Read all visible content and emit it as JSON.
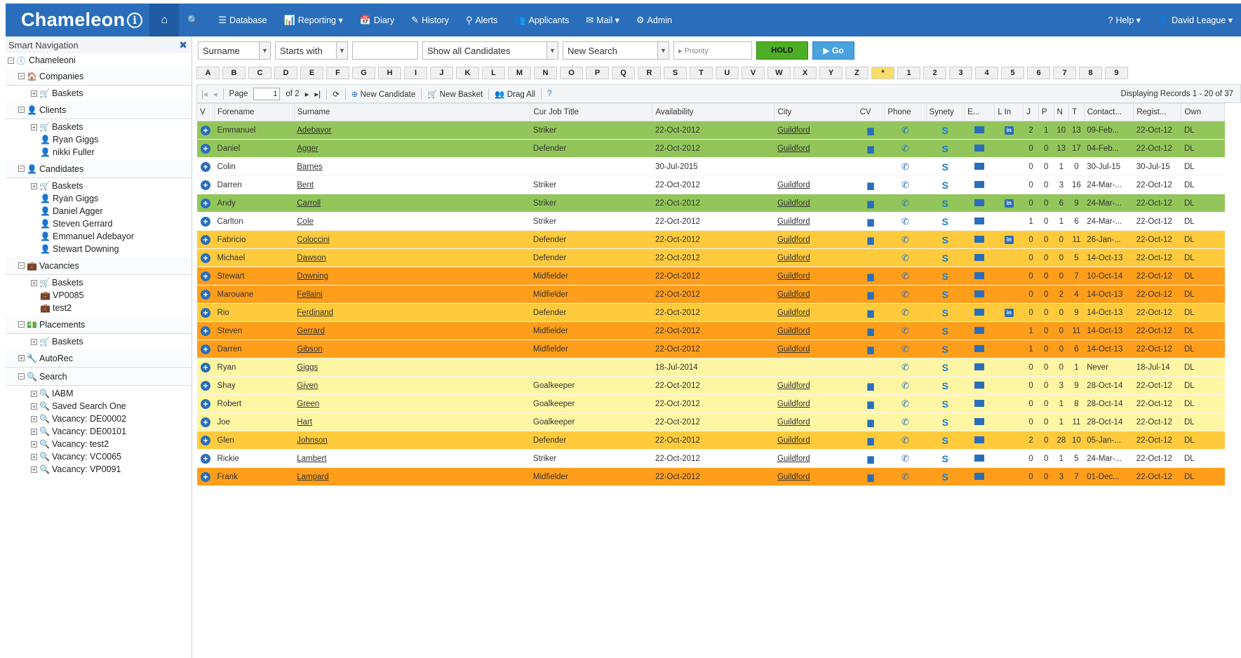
{
  "app": {
    "brand": "Chameleon",
    "brand_suffix": "i"
  },
  "nav": {
    "items": [
      {
        "icon": "🔍",
        "label": ""
      },
      {
        "icon": "☰",
        "label": "Database"
      },
      {
        "icon": "📊",
        "label": "Reporting ▾"
      },
      {
        "icon": "📅",
        "label": "Diary"
      },
      {
        "icon": "✎",
        "label": "History"
      },
      {
        "icon": "⚲",
        "label": "Alerts"
      },
      {
        "icon": "👥",
        "label": "Applicants"
      },
      {
        "icon": "✉",
        "label": "Mail ▾"
      },
      {
        "icon": "⚙",
        "label": "Admin"
      }
    ],
    "help": "Help ▾",
    "user": "David League ▾"
  },
  "sidebar": {
    "title": "Smart Navigation",
    "root": "Chameleoni",
    "sections": [
      {
        "label": "Companies",
        "icon": "🏠",
        "children": [
          {
            "label": "Baskets",
            "icon": "🛒",
            "pm": "+"
          }
        ]
      },
      {
        "label": "Clients",
        "icon": "👤",
        "children": [
          {
            "label": "Baskets",
            "icon": "🛒",
            "pm": "+"
          },
          {
            "label": "Ryan Giggs",
            "icon": "👤",
            "pm": ""
          },
          {
            "label": "nikki Fuller",
            "icon": "👤",
            "pm": ""
          }
        ]
      },
      {
        "label": "Candidates",
        "icon": "👤",
        "children": [
          {
            "label": "Baskets",
            "icon": "🛒",
            "pm": "+"
          },
          {
            "label": "Ryan Giggs",
            "icon": "👤",
            "pm": ""
          },
          {
            "label": "Daniel Agger",
            "icon": "👤",
            "pm": ""
          },
          {
            "label": "Steven Gerrard",
            "icon": "👤",
            "pm": ""
          },
          {
            "label": "Emmanuel Adebayor",
            "icon": "👤",
            "pm": ""
          },
          {
            "label": "Stewart Downing",
            "icon": "👤",
            "pm": ""
          }
        ]
      },
      {
        "label": "Vacancies",
        "icon": "💼",
        "children": [
          {
            "label": "Baskets",
            "icon": "🛒",
            "pm": "+"
          },
          {
            "label": "VP0085",
            "icon": "💼",
            "pm": ""
          },
          {
            "label": "test2",
            "icon": "💼",
            "pm": ""
          }
        ]
      },
      {
        "label": "Placements",
        "icon": "💵",
        "children": [
          {
            "label": "Baskets",
            "icon": "🛒",
            "pm": "+"
          }
        ]
      },
      {
        "label": "AutoRec",
        "icon": "🔧",
        "pm": "+",
        "children": []
      },
      {
        "label": "Search",
        "icon": "🔍",
        "children": [
          {
            "label": "IABM",
            "icon": "🔍",
            "pm": "+"
          },
          {
            "label": "Saved Search One",
            "icon": "🔍",
            "pm": "+"
          },
          {
            "label": "Vacancy: DE00002",
            "icon": "🔍",
            "pm": "+"
          },
          {
            "label": "Vacancy: DE00101",
            "icon": "🔍",
            "pm": "+"
          },
          {
            "label": "Vacancy: test2",
            "icon": "🔍",
            "pm": "+"
          },
          {
            "label": "Vacancy: VC0065",
            "icon": "🔍",
            "pm": "+"
          },
          {
            "label": "Vacancy: VP0091",
            "icon": "🔍",
            "pm": "+"
          }
        ]
      }
    ]
  },
  "filters": {
    "field": "Surname",
    "operator": "Starts with",
    "value": "",
    "show": "Show all Candidates",
    "search": "New Search",
    "priority_placeholder": "▸ Priority",
    "hold": "HOLD",
    "go": "▶ Go"
  },
  "alphabet": [
    "A",
    "B",
    "C",
    "D",
    "E",
    "F",
    "G",
    "H",
    "I",
    "J",
    "K",
    "L",
    "M",
    "N",
    "O",
    "P",
    "Q",
    "R",
    "S",
    "T",
    "U",
    "V",
    "W",
    "X",
    "Y",
    "Z",
    "*",
    "1",
    "2",
    "3",
    "4",
    "5",
    "6",
    "7",
    "8",
    "9"
  ],
  "toolbar": {
    "page_label": "Page",
    "page_value": "1",
    "page_of": "of 2",
    "new_candidate": "New Candidate",
    "new_basket": "New Basket",
    "drag_all": "Drag All",
    "display": "Displaying Records 1 - 20 of 37"
  },
  "columns": [
    "V",
    "Forename",
    "Surname",
    "Cur Job Title",
    "Availability",
    "City",
    "CV",
    "Phone",
    "Synety",
    "E...",
    "L In",
    "J",
    "P",
    "N",
    "T",
    "Contact...",
    "Regist...",
    "Own"
  ],
  "rows": [
    {
      "c": "green",
      "f": "Emmanuel",
      "s": "Adebayor",
      "j": "Striker",
      "a": "22-Oct-2012",
      "city": "Guildford",
      "cv": true,
      "li": true,
      "J": "2",
      "P": "1",
      "N": "10",
      "T": "13",
      "con": "09-Feb...",
      "reg": "22-Oct-12",
      "own": "DL"
    },
    {
      "c": "green",
      "f": "Daniel",
      "s": "Agger",
      "j": "Defender",
      "a": "22-Oct-2012",
      "city": "Guildford",
      "cv": true,
      "li": false,
      "J": "0",
      "P": "0",
      "N": "13",
      "T": "17",
      "con": "04-Feb...",
      "reg": "22-Oct-12",
      "own": "DL"
    },
    {
      "c": "white",
      "f": "Colin",
      "s": "Barnes",
      "j": "",
      "a": "30-Jul-2015",
      "city": "",
      "cv": false,
      "li": false,
      "J": "0",
      "P": "0",
      "N": "1",
      "T": "0",
      "con": "30-Jul-15",
      "reg": "30-Jul-15",
      "own": "DL"
    },
    {
      "c": "white",
      "f": "Darren",
      "s": "Bent",
      "j": "Striker",
      "a": "22-Oct-2012",
      "city": "Guildford",
      "cv": true,
      "li": false,
      "J": "0",
      "P": "0",
      "N": "3",
      "T": "16",
      "con": "24-Mar-...",
      "reg": "22-Oct-12",
      "own": "DL"
    },
    {
      "c": "green",
      "f": "Andy",
      "s": "Carroll",
      "j": "Striker",
      "a": "22-Oct-2012",
      "city": "Guildford",
      "cv": true,
      "li": true,
      "J": "0",
      "P": "0",
      "N": "6",
      "T": "9",
      "con": "24-Mar-...",
      "reg": "22-Oct-12",
      "own": "DL"
    },
    {
      "c": "white",
      "f": "Carlton",
      "s": "Cole",
      "j": "Striker",
      "a": "22-Oct-2012",
      "city": "Guildford",
      "cv": true,
      "li": false,
      "J": "1",
      "P": "0",
      "N": "1",
      "T": "6",
      "con": "24-Mar-...",
      "reg": "22-Oct-12",
      "own": "DL"
    },
    {
      "c": "amber",
      "f": "Fabricio",
      "s": "Coloccini",
      "j": "Defender",
      "a": "22-Oct-2012",
      "city": "Guildford",
      "cv": true,
      "li": true,
      "J": "0",
      "P": "0",
      "N": "0",
      "T": "11",
      "con": "26-Jan-...",
      "reg": "22-Oct-12",
      "own": "DL"
    },
    {
      "c": "amber",
      "f": "Michael",
      "s": "Dawson",
      "j": "Defender",
      "a": "22-Oct-2012",
      "city": "Guildford",
      "cv": false,
      "li": false,
      "J": "0",
      "P": "0",
      "N": "0",
      "T": "5",
      "con": "14-Oct-13",
      "reg": "22-Oct-12",
      "own": "DL"
    },
    {
      "c": "orange",
      "f": "Stewart",
      "s": "Downing",
      "j": "Midfielder",
      "a": "22-Oct-2012",
      "city": "Guildford",
      "cv": true,
      "li": false,
      "J": "0",
      "P": "0",
      "N": "0",
      "T": "7",
      "con": "10-Oct-14",
      "reg": "22-Oct-12",
      "own": "DL"
    },
    {
      "c": "orange",
      "f": "Marouane",
      "s": "Fellaini",
      "j": "Midfielder",
      "a": "22-Oct-2012",
      "city": "Guildford",
      "cv": true,
      "li": false,
      "J": "0",
      "P": "0",
      "N": "2",
      "T": "4",
      "con": "14-Oct-13",
      "reg": "22-Oct-12",
      "own": "DL"
    },
    {
      "c": "amber",
      "f": "Rio",
      "s": "Ferdinand",
      "j": "Defender",
      "a": "22-Oct-2012",
      "city": "Guildford",
      "cv": true,
      "li": true,
      "J": "0",
      "P": "0",
      "N": "0",
      "T": "9",
      "con": "14-Oct-13",
      "reg": "22-Oct-12",
      "own": "DL"
    },
    {
      "c": "orange",
      "f": "Steven",
      "s": "Gerrard",
      "j": "Midfielder",
      "a": "22-Oct-2012",
      "city": "Guildford",
      "cv": true,
      "li": false,
      "J": "1",
      "P": "0",
      "N": "0",
      "T": "11",
      "con": "14-Oct-13",
      "reg": "22-Oct-12",
      "own": "DL"
    },
    {
      "c": "orange",
      "f": "Darren",
      "s": "Gibson",
      "j": "Midfielder",
      "a": "22-Oct-2012",
      "city": "Guildford",
      "cv": true,
      "li": false,
      "J": "1",
      "P": "0",
      "N": "0",
      "T": "6",
      "con": "14-Oct-13",
      "reg": "22-Oct-12",
      "own": "DL"
    },
    {
      "c": "lyellow",
      "f": "Ryan",
      "s": "Giggs",
      "j": "",
      "a": "18-Jul-2014",
      "city": "",
      "cv": false,
      "li": false,
      "J": "0",
      "P": "0",
      "N": "0",
      "T": "1",
      "con": "Never",
      "reg": "18-Jul-14",
      "own": "DL"
    },
    {
      "c": "lyellow",
      "f": "Shay",
      "s": "Given",
      "j": "Goalkeeper",
      "a": "22-Oct-2012",
      "city": "Guildford",
      "cv": true,
      "li": false,
      "J": "0",
      "P": "0",
      "N": "3",
      "T": "9",
      "con": "28-Oct-14",
      "reg": "22-Oct-12",
      "own": "DL"
    },
    {
      "c": "lyellow",
      "f": "Robert",
      "s": "Green",
      "j": "Goalkeeper",
      "a": "22-Oct-2012",
      "city": "Guildford",
      "cv": true,
      "li": false,
      "J": "0",
      "P": "0",
      "N": "1",
      "T": "8",
      "con": "28-Oct-14",
      "reg": "22-Oct-12",
      "own": "DL"
    },
    {
      "c": "lyellow",
      "f": "Joe",
      "s": "Hart",
      "j": "Goalkeeper",
      "a": "22-Oct-2012",
      "city": "Guildford",
      "cv": true,
      "li": false,
      "J": "0",
      "P": "0",
      "N": "1",
      "T": "11",
      "con": "28-Oct-14",
      "reg": "22-Oct-12",
      "own": "DL"
    },
    {
      "c": "amber",
      "f": "Glen",
      "s": "Johnson",
      "j": "Defender",
      "a": "22-Oct-2012",
      "city": "Guildford",
      "cv": true,
      "li": false,
      "J": "2",
      "P": "0",
      "N": "28",
      "T": "10",
      "con": "05-Jan-...",
      "reg": "22-Oct-12",
      "own": "DL"
    },
    {
      "c": "white",
      "f": "Rickie",
      "s": "Lambert",
      "j": "Striker",
      "a": "22-Oct-2012",
      "city": "Guildford",
      "cv": true,
      "li": false,
      "J": "0",
      "P": "0",
      "N": "1",
      "T": "5",
      "con": "24-Mar-...",
      "reg": "22-Oct-12",
      "own": "DL"
    },
    {
      "c": "orange",
      "f": "Frank",
      "s": "Lampard",
      "j": "Midfielder",
      "a": "22-Oct-2012",
      "city": "Guildford",
      "cv": true,
      "li": false,
      "J": "0",
      "P": "0",
      "N": "3",
      "T": "7",
      "con": "01-Dec...",
      "reg": "22-Oct-12",
      "own": "DL"
    }
  ]
}
